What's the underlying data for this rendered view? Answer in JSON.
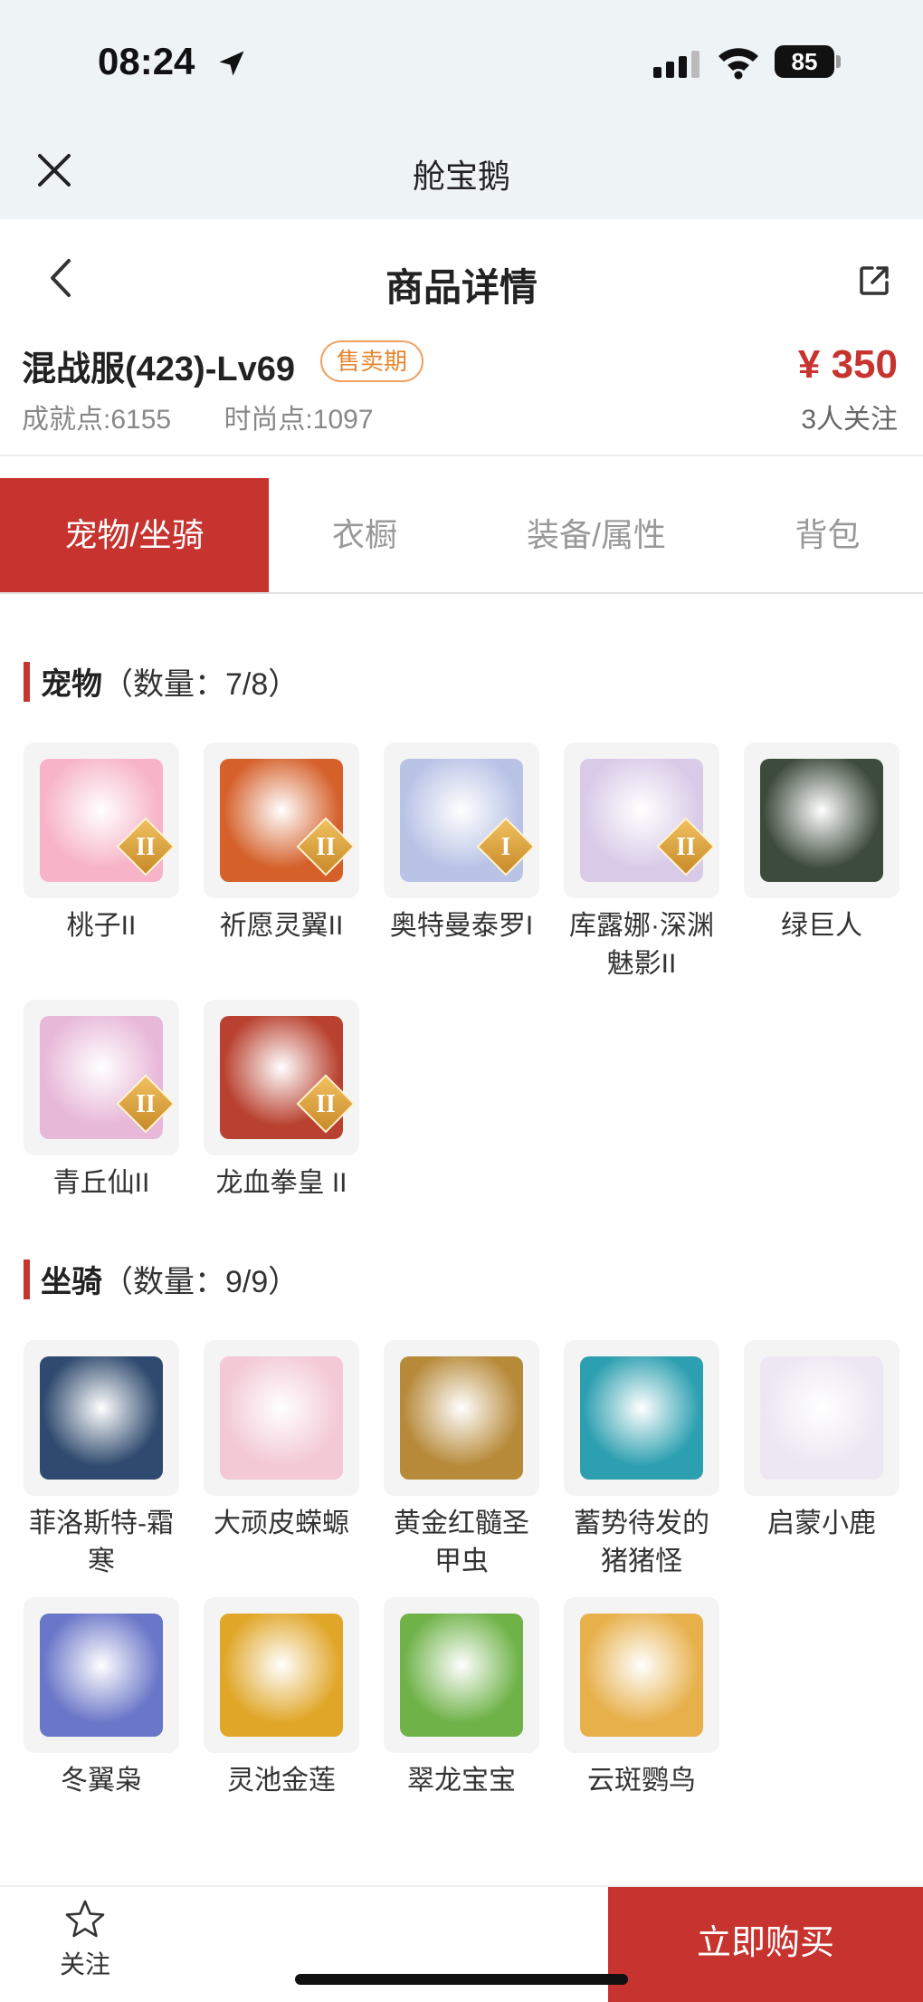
{
  "status_bar": {
    "time": "08:24",
    "battery": "85"
  },
  "miniapp": {
    "title": "舱宝鹅"
  },
  "nav": {
    "title": "商品详情"
  },
  "product": {
    "name": "混战服(423)-Lv69",
    "badge": "售卖期",
    "price": "¥ 350",
    "achievement_label": "成就点:",
    "achievement_value": "6155",
    "fashion_label": "时尚点:",
    "fashion_value": "1097",
    "followers": "3人关注"
  },
  "tabs": [
    "宠物/坐骑",
    "衣橱",
    "装备/属性",
    "背包"
  ],
  "pets": {
    "title": "宠物",
    "count": "（数量：7/8）",
    "items": [
      {
        "name": "桃子II",
        "tier": "II",
        "color": "#f7b3c8",
        "icon": "pink-bunny"
      },
      {
        "name": "祈愿灵翼II",
        "tier": "II",
        "color": "#d5602a",
        "icon": "griffin"
      },
      {
        "name": "奥特曼泰罗I",
        "tier": "I",
        "color": "#b9c3e6",
        "icon": "ultraman"
      },
      {
        "name": "库露娜·深渊魅影II",
        "tier": "II",
        "color": "#d9cbe8",
        "icon": "phantom-girl"
      },
      {
        "name": "绿巨人",
        "tier": "",
        "color": "#3d4b3c",
        "icon": "hulk"
      },
      {
        "name": "青丘仙II",
        "tier": "II",
        "color": "#e8b8d8",
        "icon": "fox-fairy"
      },
      {
        "name": "龙血拳皇 II",
        "tier": "II",
        "color": "#b9412f",
        "icon": "dragon-boxer"
      }
    ]
  },
  "mounts": {
    "title": "坐骑",
    "count": "（数量：9/9）",
    "items": [
      {
        "name": "菲洛斯特-霜寒",
        "color": "#2f4a6e",
        "icon": "frost-dragon"
      },
      {
        "name": "大顽皮蝾螈",
        "color": "#f3c9d6",
        "icon": "axolotl"
      },
      {
        "name": "黄金红髓圣甲虫",
        "color": "#b78a3a",
        "icon": "golden-beetle"
      },
      {
        "name": "蓄势待发的猪猪怪",
        "color": "#2c9fb0",
        "icon": "pig-monster"
      },
      {
        "name": "启蒙小鹿",
        "color": "#ece7f2",
        "icon": "fawn"
      },
      {
        "name": "冬翼枭",
        "color": "#6a76c8",
        "icon": "owl"
      },
      {
        "name": "灵池金莲",
        "color": "#e0a628",
        "icon": "golden-lotus"
      },
      {
        "name": "翠龙宝宝",
        "color": "#6fb248",
        "icon": "baby-dragon"
      },
      {
        "name": "云斑鹦鸟",
        "color": "#e7b04a",
        "icon": "parrot"
      }
    ]
  },
  "bottom": {
    "follow_label": "关注",
    "buy_label": "立即购买"
  },
  "colors": {
    "accent": "#c7332e",
    "badge": "#e6862e",
    "header_bg": "#eef3f6"
  }
}
